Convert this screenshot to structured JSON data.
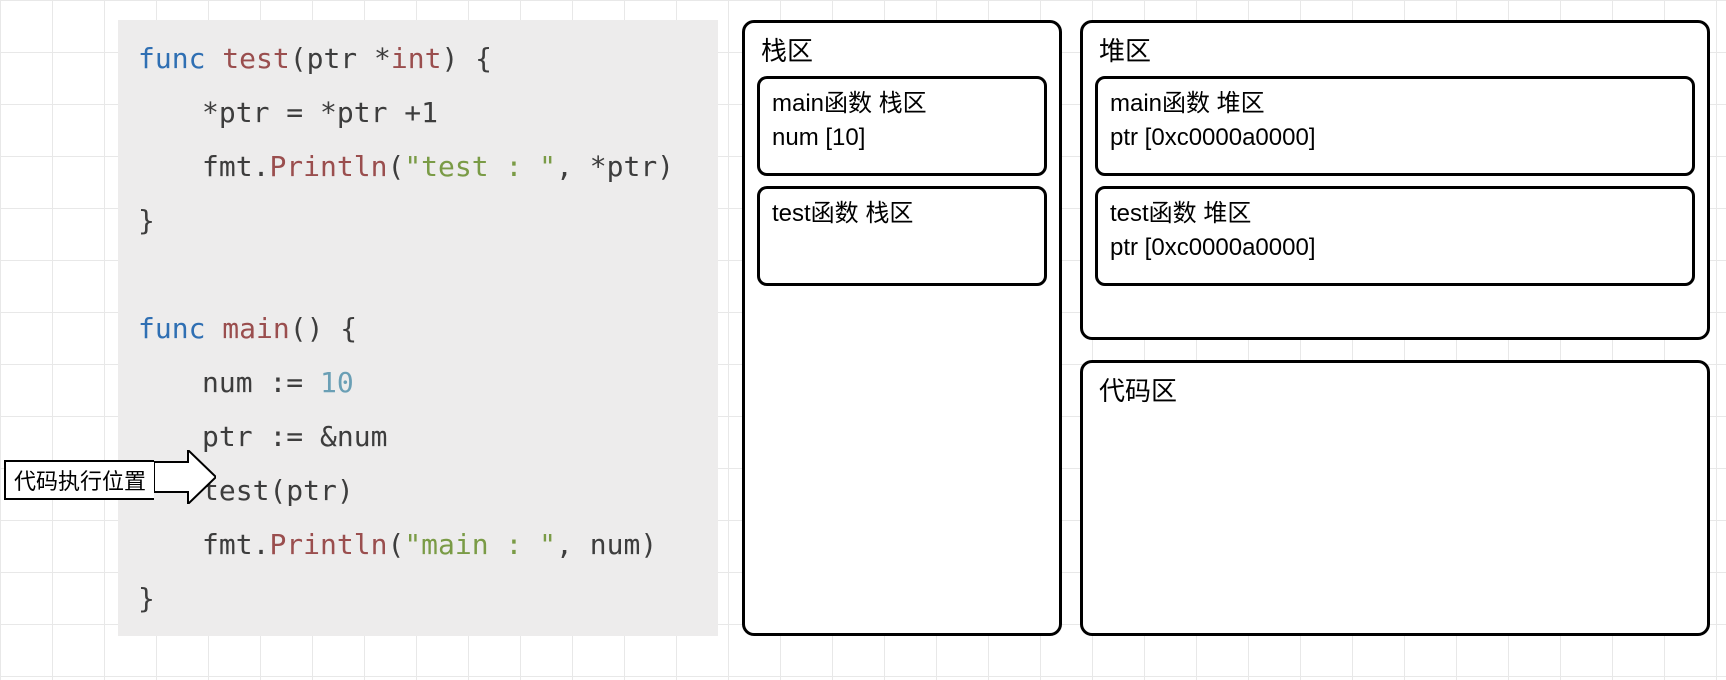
{
  "pointer": {
    "label": "代码执行位置"
  },
  "code": {
    "l1_func": "func",
    "l1_name": "test",
    "l1_params_open": "(ptr ",
    "l1_star": "*",
    "l1_type": "int",
    "l1_params_close": ") {",
    "l2": "*ptr = *ptr +1",
    "l3_pkg": "fmt",
    "l3_dot": ".",
    "l3_fn": "Println",
    "l3_open": "(",
    "l3_str": "\"test : \"",
    "l3_rest": ", *ptr)",
    "l4": "}",
    "l6_func": "func",
    "l6_name": "main",
    "l6_rest": "() {",
    "l7_a": "num ",
    "l7_op": ":=",
    "l7_b": " ",
    "l7_num": "10",
    "l8_a": "ptr ",
    "l8_op": ":=",
    "l8_b": " &num",
    "l9": "test(ptr)",
    "l10_pkg": "fmt",
    "l10_dot": ".",
    "l10_fn": "Println",
    "l10_open": "(",
    "l10_str": "\"main : \"",
    "l10_rest": ", num)",
    "l11": "}"
  },
  "stack": {
    "title": "栈区",
    "main": {
      "title": "main函数 栈区",
      "line1": "num [10]"
    },
    "test": {
      "title": "test函数 栈区"
    }
  },
  "heap": {
    "title": "堆区",
    "main": {
      "title": "main函数 堆区",
      "line1": "ptr [0xc0000a0000]"
    },
    "test": {
      "title": "test函数 堆区",
      "line1": "ptr [0xc0000a0000]"
    }
  },
  "codearea": {
    "title": "代码区"
  },
  "watermark": ""
}
